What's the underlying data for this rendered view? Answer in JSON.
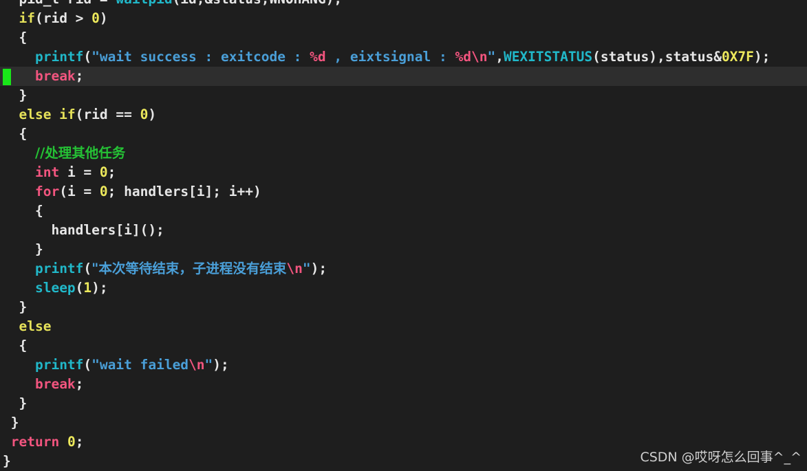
{
  "editor": {
    "lines": [
      [
        {
          "t": "  pid_t rid = ",
          "c": ""
        },
        {
          "t": "waitpid",
          "c": "fn"
        },
        {
          "t": "(id,&status,WNOHANG);",
          "c": ""
        }
      ],
      [
        {
          "t": "  ",
          "c": ""
        },
        {
          "t": "if",
          "c": "kw"
        },
        {
          "t": "(rid > ",
          "c": ""
        },
        {
          "t": "0",
          "c": "num"
        },
        {
          "t": ")",
          "c": ""
        }
      ],
      [
        {
          "t": "  {",
          "c": ""
        }
      ],
      [
        {
          "t": "    ",
          "c": ""
        },
        {
          "t": "printf",
          "c": "fn"
        },
        {
          "t": "(",
          "c": ""
        },
        {
          "t": "\"wait success : exitcode : ",
          "c": "str"
        },
        {
          "t": "%d",
          "c": "esc"
        },
        {
          "t": " , eixtsignal : ",
          "c": "str"
        },
        {
          "t": "%d\\n",
          "c": "esc"
        },
        {
          "t": "\"",
          "c": "str"
        },
        {
          "t": ",",
          "c": ""
        },
        {
          "t": "WEXITSTATUS",
          "c": "fn"
        },
        {
          "t": "(status),status&",
          "c": ""
        },
        {
          "t": "0X7F",
          "c": "num"
        },
        {
          "t": ");",
          "c": ""
        }
      ],
      [
        {
          "t": "    ",
          "c": ""
        },
        {
          "t": "break",
          "c": "red"
        },
        {
          "t": ";",
          "c": ""
        }
      ],
      [
        {
          "t": "  }",
          "c": ""
        }
      ],
      [
        {
          "t": "  ",
          "c": ""
        },
        {
          "t": "else if",
          "c": "kw"
        },
        {
          "t": "(rid == ",
          "c": ""
        },
        {
          "t": "0",
          "c": "num"
        },
        {
          "t": ")",
          "c": ""
        }
      ],
      [
        {
          "t": "  {",
          "c": ""
        }
      ],
      [
        {
          "t": "    ",
          "c": ""
        },
        {
          "t": "//处理其他任务",
          "c": "cmt"
        }
      ],
      [
        {
          "t": "    ",
          "c": ""
        },
        {
          "t": "int",
          "c": "red"
        },
        {
          "t": " i = ",
          "c": ""
        },
        {
          "t": "0",
          "c": "num"
        },
        {
          "t": ";",
          "c": ""
        }
      ],
      [
        {
          "t": "    ",
          "c": ""
        },
        {
          "t": "for",
          "c": "red"
        },
        {
          "t": "(i = ",
          "c": ""
        },
        {
          "t": "0",
          "c": "num"
        },
        {
          "t": "; handlers[i]; i++)",
          "c": ""
        }
      ],
      [
        {
          "t": "    {",
          "c": ""
        }
      ],
      [
        {
          "t": "      handlers[i]();",
          "c": ""
        }
      ],
      [
        {
          "t": "    }",
          "c": ""
        }
      ],
      [
        {
          "t": "    ",
          "c": ""
        },
        {
          "t": "printf",
          "c": "fn"
        },
        {
          "t": "(",
          "c": ""
        },
        {
          "t": "\"本次等待结束，子进程没有结束",
          "c": "str"
        },
        {
          "t": "\\n",
          "c": "esc"
        },
        {
          "t": "\"",
          "c": "str"
        },
        {
          "t": ");",
          "c": ""
        }
      ],
      [
        {
          "t": "    ",
          "c": ""
        },
        {
          "t": "sleep",
          "c": "fn"
        },
        {
          "t": "(",
          "c": ""
        },
        {
          "t": "1",
          "c": "num"
        },
        {
          "t": ");",
          "c": ""
        }
      ],
      [
        {
          "t": "  }",
          "c": ""
        }
      ],
      [
        {
          "t": "  ",
          "c": ""
        },
        {
          "t": "else",
          "c": "kw"
        }
      ],
      [
        {
          "t": "  {",
          "c": ""
        }
      ],
      [
        {
          "t": "    ",
          "c": ""
        },
        {
          "t": "printf",
          "c": "fn"
        },
        {
          "t": "(",
          "c": ""
        },
        {
          "t": "\"wait failed",
          "c": "str"
        },
        {
          "t": "\\n",
          "c": "esc"
        },
        {
          "t": "\"",
          "c": "str"
        },
        {
          "t": ");",
          "c": ""
        }
      ],
      [
        {
          "t": "    ",
          "c": ""
        },
        {
          "t": "break",
          "c": "red"
        },
        {
          "t": ";",
          "c": ""
        }
      ],
      [
        {
          "t": "  }",
          "c": ""
        }
      ],
      [
        {
          "t": " }",
          "c": ""
        }
      ],
      [
        {
          "t": " ",
          "c": ""
        },
        {
          "t": "return",
          "c": "red"
        },
        {
          "t": " ",
          "c": ""
        },
        {
          "t": "0",
          "c": "num"
        },
        {
          "t": ";",
          "c": ""
        }
      ],
      [
        {
          "t": "}",
          "c": ""
        }
      ]
    ],
    "current_line": 4,
    "cursor_color": "#19e619"
  },
  "watermark": "CSDN @哎呀怎么回事^_^"
}
